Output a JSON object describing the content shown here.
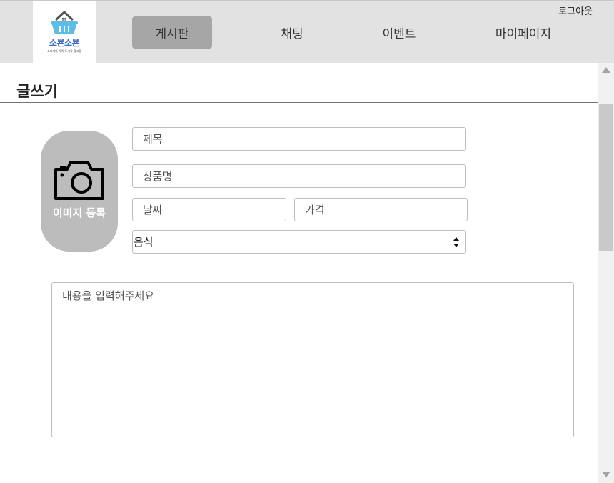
{
  "header": {
    "logo_text": "소뵨소뵨",
    "logo_subtitle": "소비자의 가족 도시락 참고용",
    "nav": [
      {
        "label": "게시판",
        "active": true
      },
      {
        "label": "채팅",
        "active": false
      },
      {
        "label": "이벤트",
        "active": false
      },
      {
        "label": "마이페이지",
        "active": false
      }
    ],
    "logout_label": "로그아웃"
  },
  "page": {
    "title": "글쓰기"
  },
  "form": {
    "image_button_label": "이미지 등록",
    "title_placeholder": "제목",
    "product_name_placeholder": "상품명",
    "date_placeholder": "날짜",
    "price_placeholder": "가격",
    "category_selected": "음식",
    "content_placeholder": "내용을 입력해주세요"
  },
  "colors": {
    "nav_active_bg": "#a6a6a6",
    "topbar_bg": "#e2e2e2",
    "image_button_bg": "#bcbcbc",
    "logo_accent": "#3d6fc4",
    "logo_basket": "#5bbde8"
  }
}
